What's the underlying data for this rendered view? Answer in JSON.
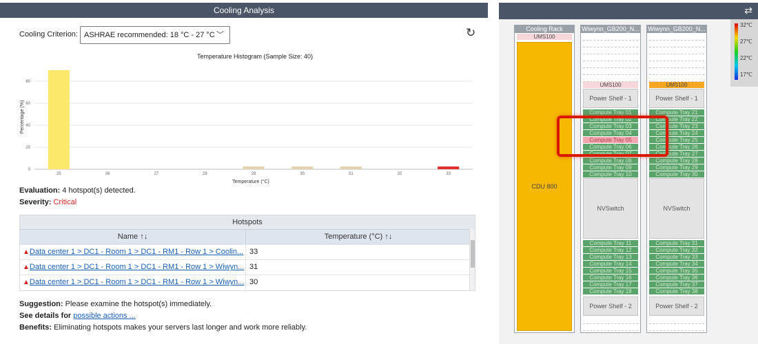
{
  "analysis": {
    "title": "Cooling Analysis",
    "criterion_label": "Cooling Criterion:",
    "criterion_value": "ASHRAE recommended: 18 °C - 27 °C",
    "chevron_icon": "chevron-down-icon",
    "refresh_icon": "refresh-icon"
  },
  "chart_data": {
    "type": "bar",
    "title": "Temperature Histogram (Sample Size: 40)",
    "xlabel": "Temperature (°C)",
    "ylabel": "Percentage (%)",
    "categories": [
      "25",
      "26",
      "27",
      "28",
      "29",
      "30",
      "31",
      "32",
      "33"
    ],
    "values": [
      90,
      0,
      0,
      0,
      2.5,
      2.5,
      2.5,
      0,
      2.5
    ],
    "colors": [
      "#fce86b",
      "#e3d3b0",
      "#e3d3b0",
      "#e3d3b0",
      "#e3d3b0",
      "#e3d3b0",
      "#e3d3b0",
      "#e3d3b0",
      "#e03131"
    ],
    "yticks": [
      "0",
      "20",
      "40",
      "60",
      "80"
    ],
    "ylim": [
      0,
      95
    ],
    "grid": true
  },
  "evaluation": {
    "label": "Evaluation:",
    "text": "4 hotspot(s) detected."
  },
  "severity": {
    "label": "Severity:",
    "value": "Critical",
    "color": "#d42020"
  },
  "hotspots": {
    "title": "Hotspots",
    "columns": [
      "Name ↑↓",
      "Temperature (°C) ↑↓"
    ],
    "rows": [
      {
        "name": "Data center 1 > DC1 - Room 1 > DC1 - RM1 - Row 1 > Coolin...",
        "temp": "33"
      },
      {
        "name": "Data center 1 > DC1 - Room 1 > DC1 - RM1 - Row 1 > Wiwyn...",
        "temp": "31"
      },
      {
        "name": "Data center 1 > DC1 - Room 1 > DC1 - RM1 - Row 1 > Wiwyn...",
        "temp": "30"
      }
    ]
  },
  "suggestion": {
    "label": "Suggestion:",
    "text": "Please examine the hotspot(s) immediately."
  },
  "details": {
    "label": "See details for",
    "link": "possible actions ..."
  },
  "benefits": {
    "label": "Benefits:",
    "text": "Eliminating hotspots makes your servers last longer and work more reliably."
  },
  "racks": {
    "cooling": {
      "title": "Cooling Rack",
      "ums": "UMS100",
      "cdu": "CDU 800"
    },
    "rack1": {
      "title": "Wiwynn_GB200_N...",
      "ums": "UMS100",
      "power1": "Power Shelf - 1",
      "trays_top": [
        "Compute Tray 01",
        "Compute Tray 02",
        "Compute Tray 03",
        "Compute Tray 04",
        "Compute Tray 05",
        "Compute Tray 06",
        "Compute Tray 07",
        "Compute Tray 08",
        "Compute Tray 09",
        "Compute Tray 10"
      ],
      "nvswitch": "NVSwitch",
      "trays_bottom": [
        "Compute Tray 11",
        "Compute Tray 12",
        "Compute Tray 13",
        "Compute Tray 14",
        "Compute Tray 15",
        "Compute Tray 16",
        "Compute Tray 17",
        "Compute Tray 18"
      ],
      "power2": "Power Shelf - 2"
    },
    "rack2": {
      "title": "Wiwynn_GB200_N...",
      "ums": "UMS100",
      "power1": "Power Shelf - 1",
      "trays_top": [
        "Compute Tray 21",
        "Compute Tray 22",
        "Compute Tray 23",
        "Compute Tray 24",
        "Compute Tray 25",
        "Compute Tray 26",
        "Compute Tray 27",
        "Compute Tray 28",
        "Compute Tray 29",
        "Compute Tray 30"
      ],
      "nvswitch": "NVSwitch",
      "trays_bottom": [
        "Compute Tray 31",
        "Compute Tray 32",
        "Compute Tray 33",
        "Compute Tray 34",
        "Compute Tray 35",
        "Compute Tray 36",
        "Compute Tray 37",
        "Compute Tray 38"
      ],
      "power2": "Power Shelf - 2"
    }
  },
  "legend": {
    "labels": [
      "32℃",
      "27℃",
      "22℃",
      "17℃"
    ]
  },
  "toolbar": {
    "sync_icon": "sync-icon"
  }
}
